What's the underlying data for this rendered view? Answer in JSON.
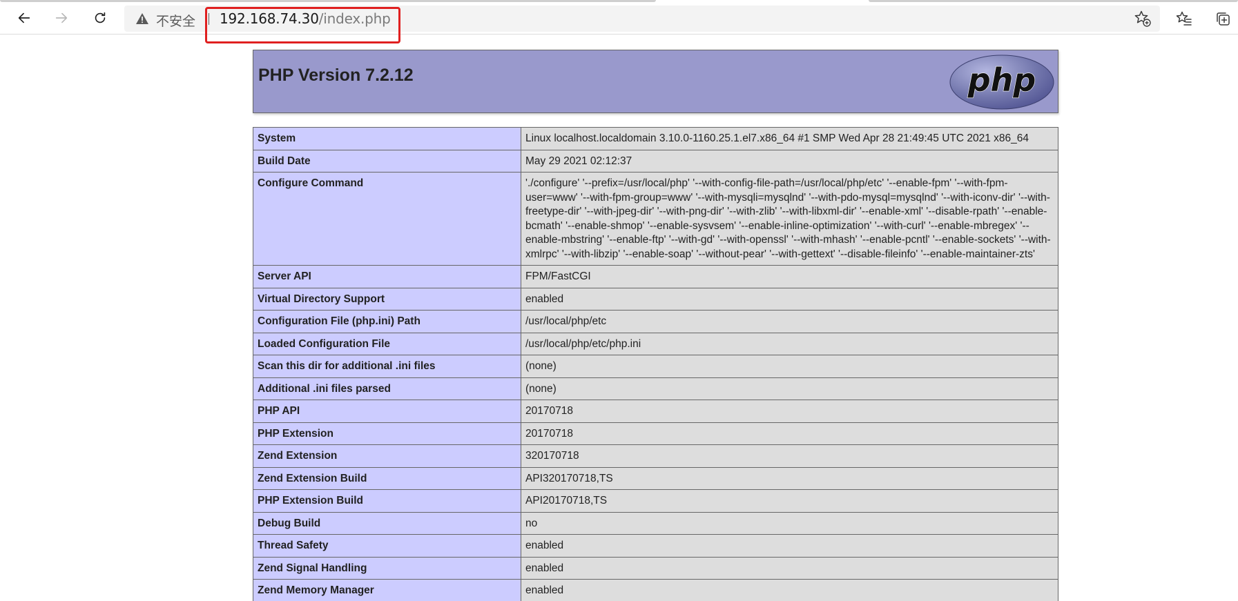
{
  "browser": {
    "security_label": "不安全",
    "url_host": "192.168.74.30",
    "url_path": "/index.php",
    "icons": {
      "back": "back-arrow-icon",
      "forward": "forward-arrow-icon",
      "reload": "reload-icon",
      "insecure": "warning-triangle-icon",
      "add_favorite": "add-favorite-star-icon",
      "favorites": "favorites-list-icon",
      "collections": "collections-icon"
    },
    "annotation_color": "#e02020"
  },
  "header": {
    "title": "PHP Version 7.2.12",
    "logo_text": "php",
    "background": "#9999cc"
  },
  "rows": [
    {
      "key": "System",
      "value": "Linux localhost.localdomain 3.10.0-1160.25.1.el7.x86_64 #1 SMP Wed Apr 28 21:49:45 UTC 2021 x86_64"
    },
    {
      "key": "Build Date",
      "value": "May 29 2021 02:12:37"
    },
    {
      "key": "Configure Command",
      "value": "'./configure' '--prefix=/usr/local/php' '--with-config-file-path=/usr/local/php/etc' '--enable-fpm' '--with-fpm-user=www' '--with-fpm-group=www' '--with-mysqli=mysqlnd' '--with-pdo-mysql=mysqlnd' '--with-iconv-dir' '--with-freetype-dir' '--with-jpeg-dir' '--with-png-dir' '--with-zlib' '--with-libxml-dir' '--enable-xml' '--disable-rpath' '--enable-bcmath' '--enable-shmop' '--enable-sysvsem' '--enable-inline-optimization' '--with-curl' '--enable-mbregex' '--enable-mbstring' '--enable-ftp' '--with-gd' '--with-openssl' '--with-mhash' '--enable-pcntl' '--enable-sockets' '--with-xmlrpc' '--with-libzip' '--enable-soap' '--without-pear' '--with-gettext' '--disable-fileinfo' '--enable-maintainer-zts'"
    },
    {
      "key": "Server API",
      "value": "FPM/FastCGI"
    },
    {
      "key": "Virtual Directory Support",
      "value": "enabled"
    },
    {
      "key": "Configuration File (php.ini) Path",
      "value": "/usr/local/php/etc"
    },
    {
      "key": "Loaded Configuration File",
      "value": "/usr/local/php/etc/php.ini"
    },
    {
      "key": "Scan this dir for additional .ini files",
      "value": "(none)"
    },
    {
      "key": "Additional .ini files parsed",
      "value": "(none)"
    },
    {
      "key": "PHP API",
      "value": "20170718"
    },
    {
      "key": "PHP Extension",
      "value": "20170718"
    },
    {
      "key": "Zend Extension",
      "value": "320170718"
    },
    {
      "key": "Zend Extension Build",
      "value": "API320170718,TS"
    },
    {
      "key": "PHP Extension Build",
      "value": "API20170718,TS"
    },
    {
      "key": "Debug Build",
      "value": "no"
    },
    {
      "key": "Thread Safety",
      "value": "enabled"
    },
    {
      "key": "Zend Signal Handling",
      "value": "enabled"
    },
    {
      "key": "Zend Memory Manager",
      "value": "enabled"
    },
    {
      "key": "",
      "value": ""
    }
  ]
}
